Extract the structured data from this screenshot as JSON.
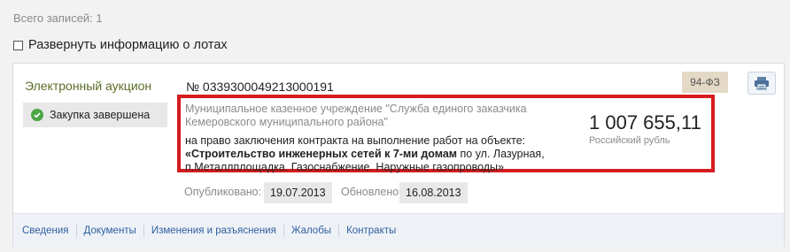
{
  "records": {
    "count_label": "Всего записей: 1"
  },
  "expand": {
    "label": "Развернуть информацию о лотах"
  },
  "card": {
    "procedure_type": "Электронный аукцион",
    "status": "Закупка завершена",
    "reg_number": "№ 0339300049213000191",
    "law_badge": "94-ФЗ",
    "customer": "Муниципальное казенное учреждение \"Служба единого заказчика Кемеровского муниципального района\"",
    "description_intro": "на право заключения контракта на выполнение работ на объекте:",
    "description_bold": "«Строительство инженерных сетей к 7-ми домам",
    "description_rest": " по ул. Лазурная, п.Металлплощадка. Газоснабжение. Наружные газопроводы»",
    "price": "1 007 655,11",
    "currency": "Российский рубль",
    "published_label": "Опубликовано:",
    "published_date": "19.07.2013",
    "updated_label": "Обновлено:",
    "updated_date": "16.08.2013",
    "tabs": [
      "Сведения",
      "Документы",
      "Изменения и разъяснения",
      "Жалобы",
      "Контракты"
    ]
  },
  "icons": {
    "status": "check-circle-icon",
    "print": "printer-icon"
  },
  "colors": {
    "highlight": "#d51c1f",
    "link": "#2f5f9f",
    "status_green": "#4ba543",
    "procedure_type": "#5a6e28"
  }
}
